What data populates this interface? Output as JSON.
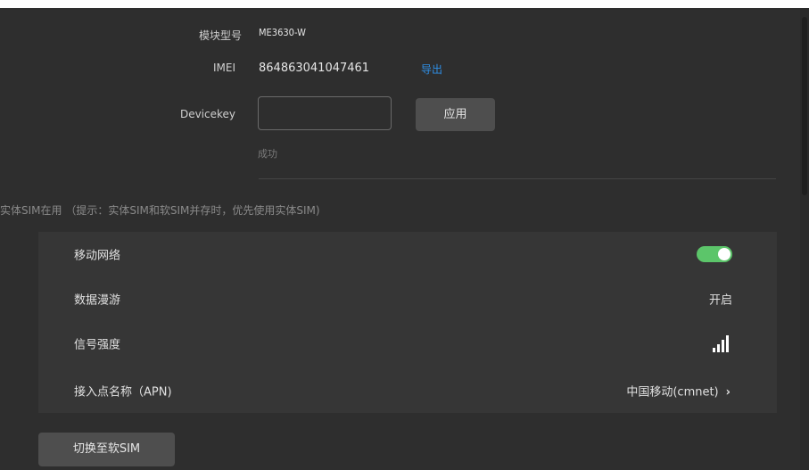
{
  "module": {
    "model_label": "模块型号",
    "model_value": "ME3630-W",
    "imei_label": "IMEI",
    "imei_value": "864863041047461",
    "export_label": "导出",
    "devicekey_label": "Devicekey",
    "devicekey_value": "",
    "devicekey_placeholder": "",
    "apply_label": "应用",
    "success_text": "成功"
  },
  "sim": {
    "status_text": "实体SIM在用 （提示：实体SIM和软SIM并存时，优先使用实体SIM)",
    "rows": {
      "mobile_network_label": "移动网络",
      "mobile_network_on": true,
      "data_roaming_label": "数据漫游",
      "data_roaming_value": "开启",
      "signal_label": "信号强度",
      "signal_bars": 4,
      "apn_label": "接入点名称（APN)",
      "apn_value": "中国移动(cmnet)",
      "apn_chevron": "›"
    },
    "switch_label": "切换至软SIM"
  },
  "colors": {
    "toggle_on": "#5cc56a",
    "link": "#2f8fe6"
  },
  "icons": {
    "signal": "signal-strength-icon",
    "chevron": "chevron-right-icon"
  }
}
